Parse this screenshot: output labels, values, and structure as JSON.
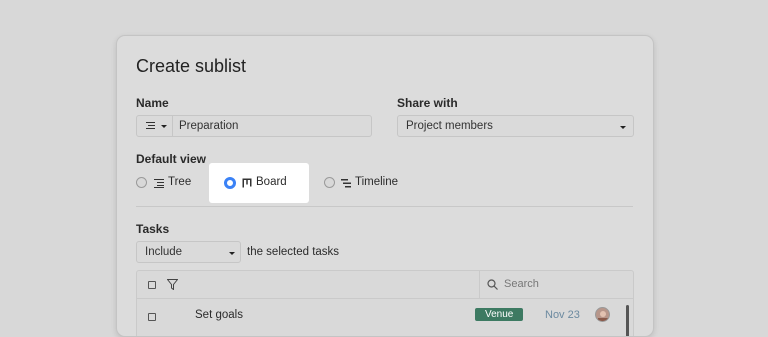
{
  "dialog": {
    "title": "Create sublist"
  },
  "name_field": {
    "label": "Name",
    "value": "Preparation"
  },
  "share_field": {
    "label": "Share with",
    "value": "Project members"
  },
  "default_view": {
    "label": "Default view",
    "options": [
      {
        "label": "Tree",
        "icon": "tree-icon",
        "selected": false
      },
      {
        "label": "Board",
        "icon": "board-icon",
        "selected": true
      },
      {
        "label": "Timeline",
        "icon": "timeline-icon",
        "selected": false
      }
    ]
  },
  "tasks": {
    "label": "Tasks",
    "mode_value": "Include",
    "mode_suffix": "the selected tasks",
    "search_placeholder": "Search",
    "rows": [
      {
        "name": "Set goals",
        "tag": "Venue",
        "date": "Nov 23"
      }
    ]
  },
  "colors": {
    "accent": "#3b82f6",
    "tag_bg": "#3d7a62",
    "page_bg": "#d8d8d8"
  }
}
